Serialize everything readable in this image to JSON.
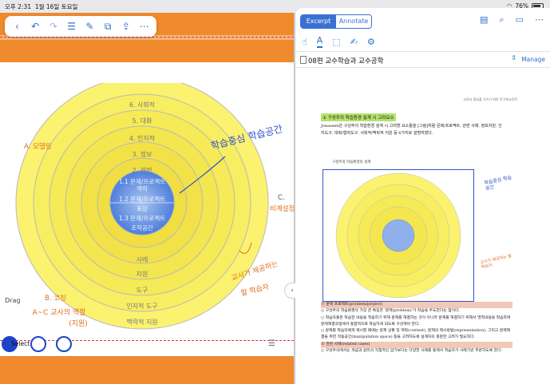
{
  "status": {
    "time": "오후 2:31",
    "date": "1월 16일 토요일",
    "battery": "76%"
  },
  "left": {
    "toolbar": {
      "back": "‹",
      "undo": "↶",
      "redo": "↷",
      "list": "☰",
      "edit": "✎",
      "copy": "⧉",
      "share": "⇪",
      "more": "⋯"
    },
    "diagram": {
      "rings": [
        "6. 사회적",
        "5. 대화",
        "4. 인지적",
        "3. 정보",
        "2. 관련",
        "1.1 문제/프로젝트 맥락",
        "1.2 문제/프로젝트 표상",
        "1.3 문제/프로젝트 조작공간",
        "사례",
        "자원",
        "도구",
        "인지적 도구",
        "맥락적 지원"
      ],
      "core": [
        "1.1 문제/프로젝트",
        "맥락",
        "1.2 문제/프로젝트",
        "표상",
        "1.3 문제/프로젝트",
        "조작공간"
      ],
      "lower": [
        "사례",
        "자원",
        "도구",
        "인지적 도구",
        "맥락적 지원"
      ],
      "upper": [
        "6. 사회적",
        "5. 대화",
        "4. 인지적",
        "3. 정보",
        "2. 관련"
      ],
      "label_a": "A. 모델링",
      "label_b": "B. 코칭",
      "label_c": "C.",
      "label_c2": "비계설정",
      "hand_blue": "학습중심 학습공간",
      "hand_orange1": "교사가 제공하는",
      "hand_orange2": "할 학습자",
      "hand_bottom1": "A~C 교사의 역할",
      "hand_bottom2": "(지원)"
    },
    "drag": "Drag",
    "select": "Select"
  },
  "right": {
    "tabs": {
      "active": "Excerpt",
      "inactive": "Annotate"
    },
    "doc_title": "08편 교수학습과 교수공학",
    "manage": "Manage",
    "header_small": "교육의 필요를 가르기 위한 학구에교육학",
    "section": "① 구성주의 학습환경 설계 시 고려요소",
    "para": "Jonassen은 구성주의 학습환경 설계 시 고려할 요소들을 [그림]처럼 문제/프로젝트, 관련 사례, 정보자원, 인지도구, 대화/협력도구, 사회적/맥락적 지원 등 6가지로 설명하였다.",
    "fig_caption": "구성주의 학습환경의 설계",
    "note_blue": "학습중심 학습공간",
    "note_orange": "교사가 제공하는 할 학습자",
    "items": [
      "① 문제 프로젝트(problem/project)",
      "○ 구성주의 학습환경의 가장 큰 특징은 '문제(problem)'가 학습을 주도한다는 점이다.",
      "○ 학습자들은 학습한 내용을 적용하기 위해 문제를 해결하는 것이 아니라 문제를 해결하기 위해서 영역내용을 학습하며 문제해결과정에서 통합적으로 학습하게 되도록 구성해야 한다.",
      "○ 문제를 학습자에게 제시할 때에는 문제 상황 및 맥락(context), 문제의 제시방법(representation), 그리고 문제해결을 위한 작동공간(manipulation space) 등을 고려하도록 설계자의 충분한 고려가 필요하다.",
      "② 관련 사례(related cases)",
      "○ 구성주의에서는 개념과 원리의 직접적인 암기보다는 다양한 사례를 통해서 학습자가 사례기반 추론하도록 한다."
    ]
  }
}
